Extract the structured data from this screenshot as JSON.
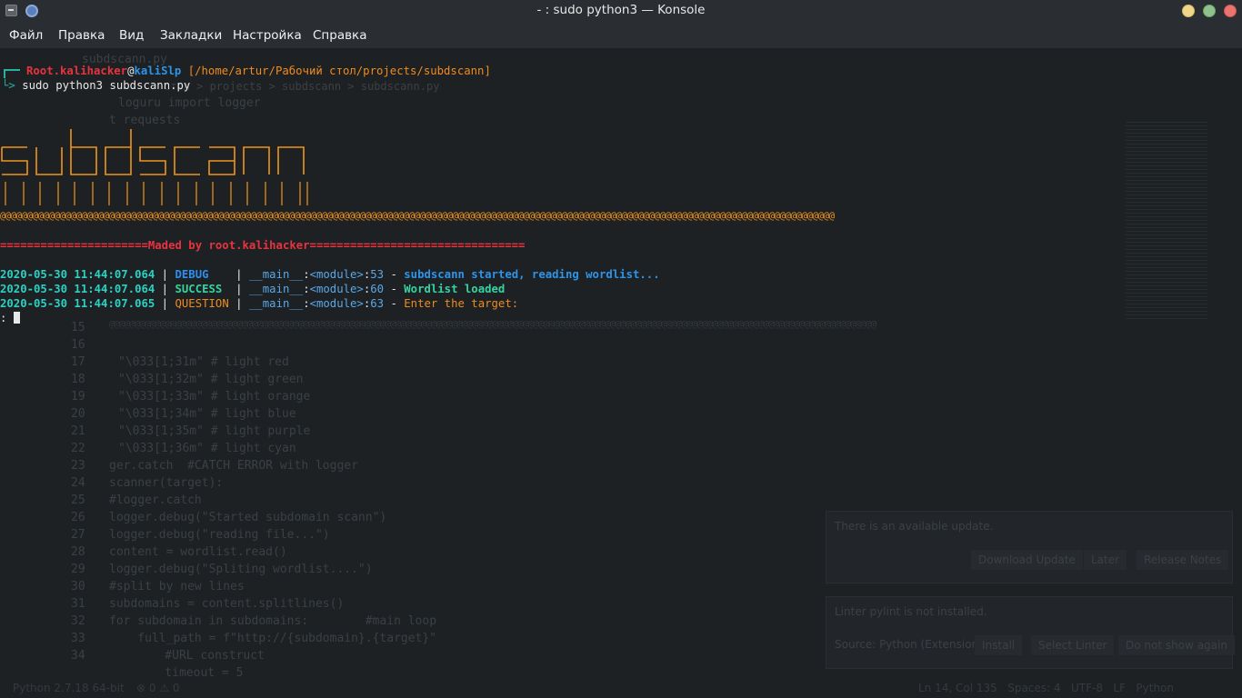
{
  "window": {
    "title": "- : sudo python3 — Konsole"
  },
  "menu": [
    "Файл",
    "Правка",
    "Вид",
    "Закладки",
    "Настройка",
    "Справка"
  ],
  "prompt": {
    "user": "Root.kalihacker",
    "at": "@",
    "host": "kaliSlp",
    "path": " [/home/artur/Рабочий стол/projects/subdscann]",
    "command": "sudo python3 subdscann.py"
  },
  "banner": {
    "text": "subdscann",
    "at_line": "@@@@@@@@@@@@@@@@@@@@@@@@@@@@@@@@@@@@@@@@@@@@@@@@@@@@@@@@@@@@@@@@@@@@@@@@@@@@@@@@@@@@@@@@@@@@@@@@@@@@@@@@@@@@@@@@@@@@@@@@@@@@@@@@@@@@@@@@@@@@@@@@@@@@@@@@@",
    "made_by": "======================Maded by root.kalihacker================================"
  },
  "logs": [
    {
      "time": "2020-05-30 11:44:07.064",
      "level": "DEBUG   ",
      "module": "__main__",
      "func": "<module>",
      "line": "53",
      "message": "subdscann started, reading wordlist..."
    },
    {
      "time": "2020-05-30 11:44:07.064",
      "level": "SUCCESS ",
      "module": "__main__",
      "func": "<module>",
      "line": "60",
      "message": "Wordlist loaded"
    },
    {
      "time": "2020-05-30 11:44:07.065",
      "level": "QUESTION",
      "module": "__main__",
      "func": "<module>",
      "line": "63",
      "message": "Enter the target:"
    }
  ],
  "input_prompt": ": ",
  "ghost": {
    "tab": "subdscann.py",
    "breadcrumb": "стол > projects > subdscann > subdscann.py",
    "code": [
      "loguru import logger",
      "t requests",
      "\"\\033[1;31m\" # light red",
      "\"\\033[1;32m\" # light green",
      "\"\\033[1;33m\" # light orange",
      "\"\\033[1;34m\" # light blue",
      "\"\\033[1;35m\" # light purple",
      "\"\\033[1;36m\" # light cyan",
      "ger.catch  #CATCH ERROR with logger",
      "scanner(target):",
      "#logger.catch",
      "logger.debug(\"Started subdomain scann\")",
      "logger.debug(\"reading file...\")",
      "content = wordlist.read()",
      "logger.debug(\"Spliting wordlist....\")",
      "#split by new lines",
      "subdomains = content.splitlines()",
      "for subdomain in subdomains:        #main loop",
      "    full_path = f\"http://{subdomain}.{target}\"",
      "    #URL construct",
      "    timeout = 5"
    ],
    "line_numbers": [
      "15",
      "16",
      "17",
      "18",
      "19",
      "20",
      "21",
      "22",
      "23",
      "24",
      "25",
      "26",
      "27",
      "28",
      "29",
      "30",
      "31",
      "32",
      "33",
      "34"
    ],
    "notif1": "There is an available update.",
    "notif1_buttons": [
      "Download Update",
      "Later",
      "Release Notes"
    ],
    "notif2": "Linter pylint is not installed.",
    "notif2_source": "Source: Python (Extension)",
    "notif2_buttons": [
      "Install",
      "Select Linter",
      "Do not show again"
    ],
    "status_left": "Python 2.7.18 64-bit",
    "status_errors": "⊗ 0 ⚠ 0",
    "status_right": "Ln 14, Col 135   Spaces: 4   UTF-8   LF   Python"
  }
}
